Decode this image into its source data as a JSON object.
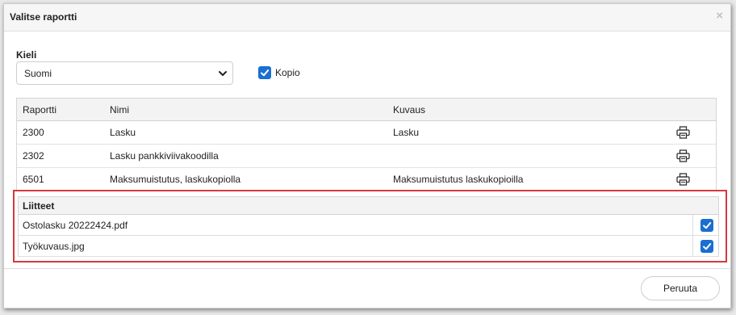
{
  "dialog": {
    "title": "Valitse raportti",
    "close_glyph": "×"
  },
  "language": {
    "label": "Kieli",
    "selected": "Suomi"
  },
  "copy": {
    "label": "Kopio",
    "checked": true
  },
  "reports": {
    "headers": {
      "code": "Raportti",
      "name": "Nimi",
      "description": "Kuvaus"
    },
    "rows": [
      {
        "code": "2300",
        "name": "Lasku",
        "description": "Lasku",
        "icon": "printer-icon"
      },
      {
        "code": "2302",
        "name": "Lasku pankkiviivakoodilla",
        "description": "",
        "icon": "printer-icon"
      },
      {
        "code": "6501",
        "name": "Maksumuistutus, laskukopiolla",
        "description": "Maksumuistutus laskukopioilla",
        "icon": "printer-icon"
      }
    ]
  },
  "attachments": {
    "header": "Liitteet",
    "items": [
      {
        "name": "Ostolasku 20222424.pdf",
        "checked": true
      },
      {
        "name": "Työkuvaus.jpg",
        "checked": true
      }
    ],
    "highlight_color": "#d23a3f"
  },
  "footer": {
    "cancel_label": "Peruuta"
  },
  "colors": {
    "accent": "#1a6fd0",
    "highlight": "#d23a3f"
  }
}
